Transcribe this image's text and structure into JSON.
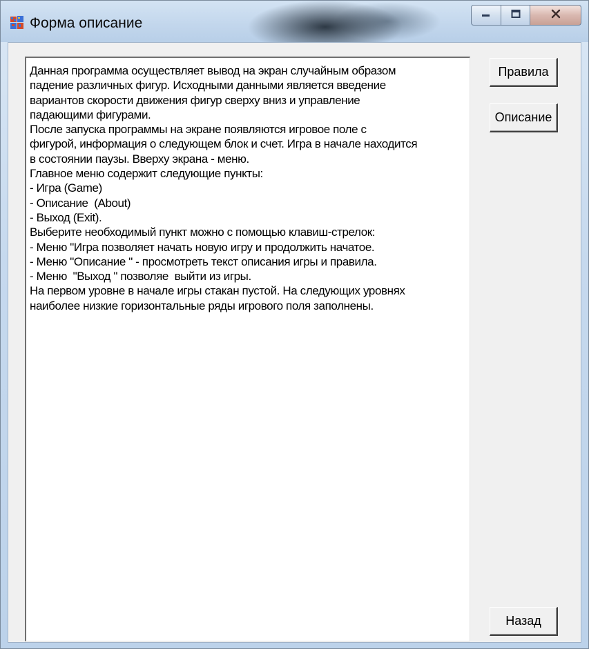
{
  "window": {
    "title": "Форма описание",
    "icons": {
      "app": "app-icon",
      "minimize": "minimize-icon",
      "maximize": "maximize-icon",
      "close": "close-icon"
    }
  },
  "memo": {
    "text": "Данная программа осуществляет вывод на экран случайным образом\nпадение различных фигур. Исходными данными является введение\nвариантов скорости движения фигур сверху вниз и управление\nпадающими фигурами.\nПосле запуска программы на экране появляются игровое поле с\nфигурой, информация о следующем блок и счет. Игра в начале находится\nв состоянии паузы. Вверху экрана - меню.\nГлавное меню содержит следующие пункты:\n- Игра (Game)\n- Описание  (About)\n- Выход (Exit).\nВыберите необходимый пункт можно с помощью клавиш-стрелок:\n- Меню \"Игра позволяет начать новую игру и продолжить начатое.\n- Меню \"Описание \" - просмотреть текст описания игры и правила.\n- Меню  \"Выход \" позволяе  выйти из игры.\nНа первом уровне в начале игры стакан пустой. На следующих уровнях\nнаиболее низкие горизонтальные ряды игрового поля заполнены."
  },
  "buttons": {
    "rules": "Правила",
    "description": "Описание",
    "back": "Назад"
  }
}
